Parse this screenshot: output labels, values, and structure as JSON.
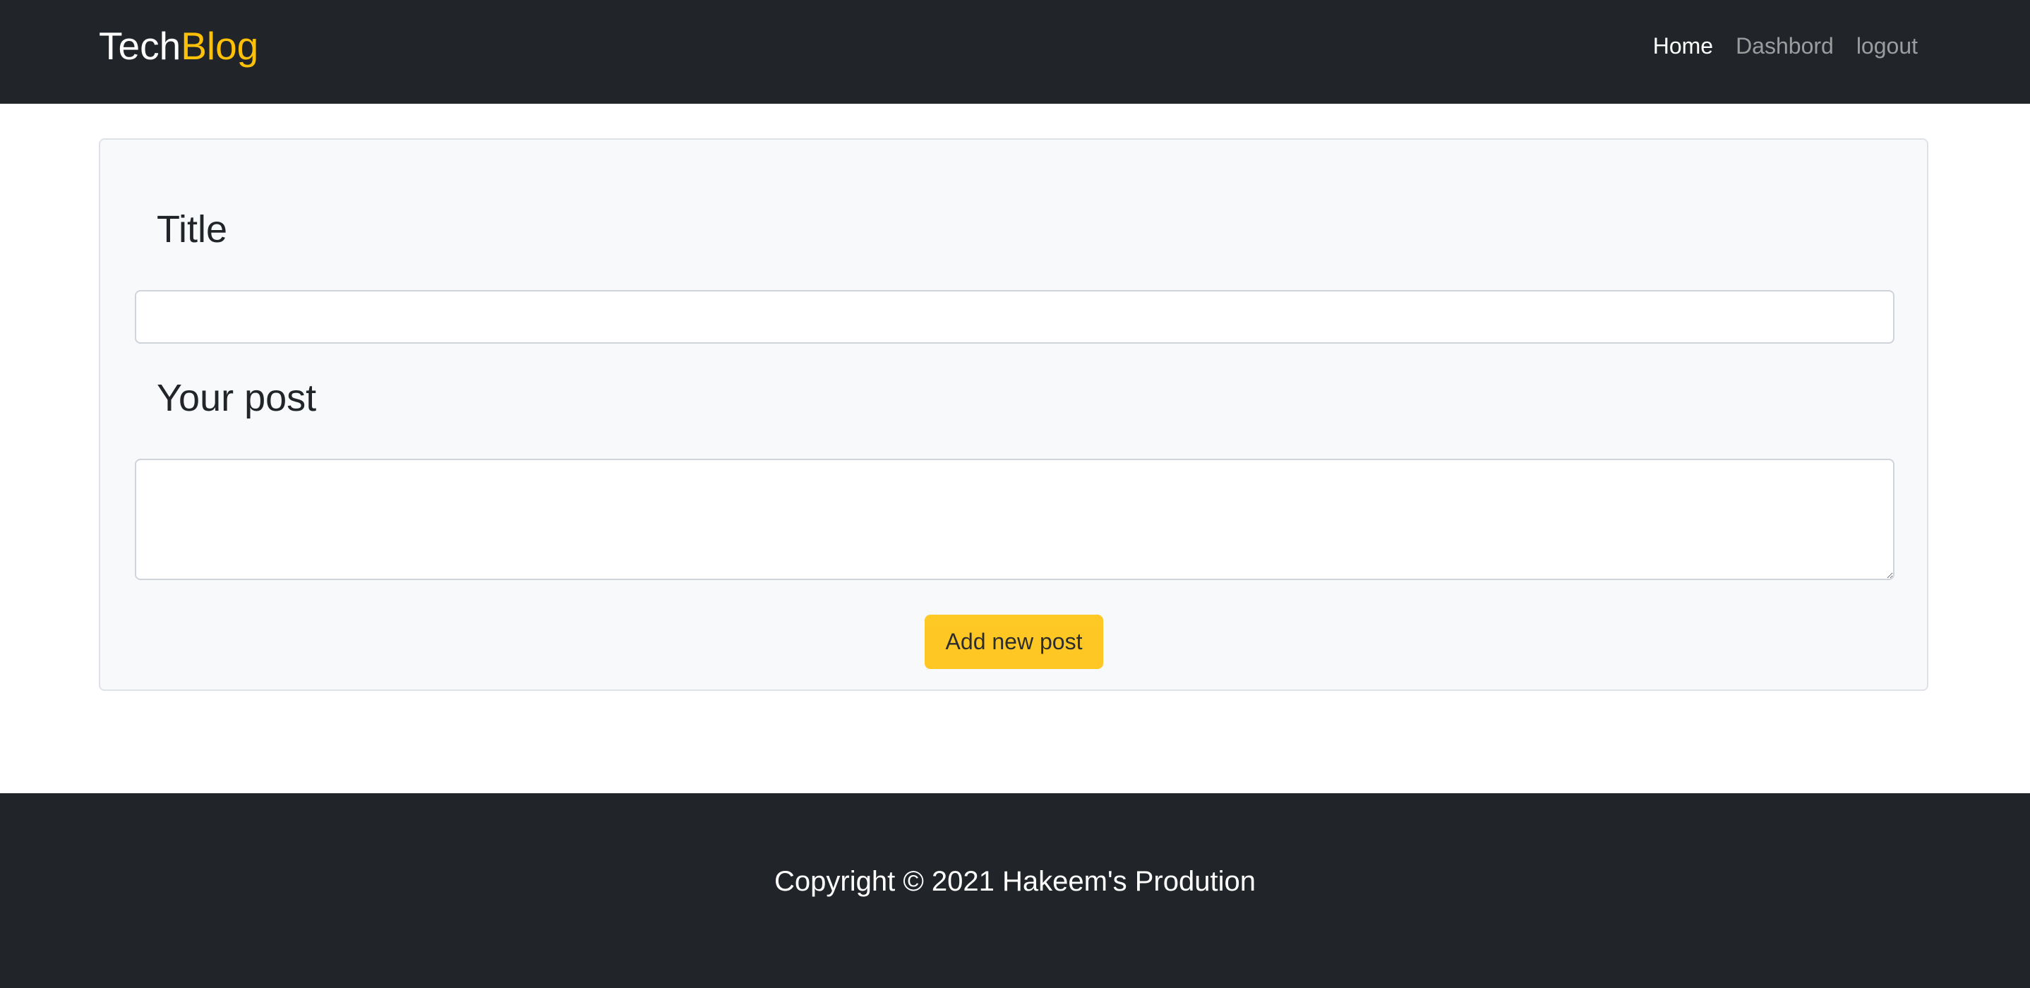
{
  "navbar": {
    "brand_primary": "Tech",
    "brand_accent": "Blog",
    "links": [
      {
        "label": "Home"
      },
      {
        "label": "Dashbord"
      },
      {
        "label": "logout"
      }
    ]
  },
  "form": {
    "title_label": "Title",
    "title_value": "",
    "post_label": "Your post",
    "post_value": "",
    "submit_label": "Add new post"
  },
  "footer": {
    "copyright": "Copyright © 2021 Hakeem's Prodution"
  },
  "colors": {
    "navbar_bg": "#212529",
    "accent": "#ffc107",
    "card_bg": "#f8f9fa"
  }
}
